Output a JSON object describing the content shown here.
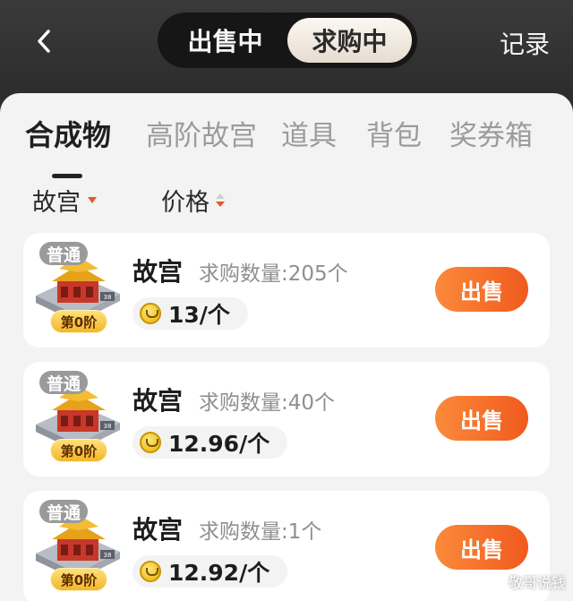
{
  "header": {
    "segments": [
      "出售中",
      "求购中"
    ],
    "active_segment": 1,
    "record_label": "记录"
  },
  "categories": [
    {
      "label": "合成物",
      "active": true
    },
    {
      "label": "高阶故宫",
      "active": false
    },
    {
      "label": "道具",
      "active": false
    },
    {
      "label": "背包",
      "active": false
    },
    {
      "label": "奖券箱",
      "active": false
    }
  ],
  "filters": {
    "type_label": "故宫",
    "price_label": "价格"
  },
  "items": [
    {
      "tier": "普通",
      "stage": "第0阶",
      "name": "故宫",
      "demand": "求购数量:205个",
      "price": "13/个",
      "sell_label": "出售"
    },
    {
      "tier": "普通",
      "stage": "第0阶",
      "name": "故宫",
      "demand": "求购数量:40个",
      "price": "12.96/个",
      "sell_label": "出售"
    },
    {
      "tier": "普通",
      "stage": "第0阶",
      "name": "故宫",
      "demand": "求购数量:1个",
      "price": "12.92/个",
      "sell_label": "出售"
    }
  ],
  "watermark": "敬哥说钱",
  "colors": {
    "accent": "#f05a1e",
    "accent_light": "#fb8a3b",
    "topbar_bg": "#2c2c2c",
    "panel_bg": "#f4f3f3"
  }
}
